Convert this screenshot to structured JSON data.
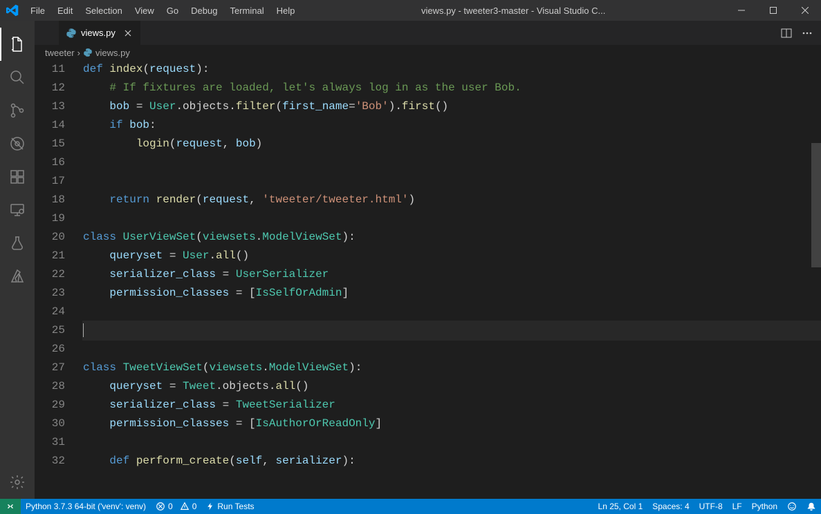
{
  "titlebar": {
    "title": "views.py - tweeter3-master - Visual Studio C...",
    "menus": [
      "File",
      "Edit",
      "Selection",
      "View",
      "Go",
      "Debug",
      "Terminal",
      "Help"
    ]
  },
  "activitybar": {
    "items": [
      {
        "name": "explorer-icon",
        "active": true
      },
      {
        "name": "search-icon",
        "active": false
      },
      {
        "name": "source-control-icon",
        "active": false
      },
      {
        "name": "debug-icon",
        "active": false
      },
      {
        "name": "extensions-icon",
        "active": false
      },
      {
        "name": "remote-explorer-icon",
        "active": false
      },
      {
        "name": "test-icon",
        "active": false
      },
      {
        "name": "azure-icon",
        "active": false
      }
    ],
    "bottom": [
      {
        "name": "settings-icon"
      }
    ]
  },
  "tab": {
    "filename": "views.py"
  },
  "breadcrumbs": {
    "segments": [
      "tweeter",
      "views.py"
    ]
  },
  "code": {
    "first_line_no": 11,
    "lines": [
      [
        [
          "tok-kw",
          "def"
        ],
        [
          "tok-punc",
          " "
        ],
        [
          "tok-fn",
          "index"
        ],
        [
          "tok-punc",
          "("
        ],
        [
          "tok-var",
          "request"
        ],
        [
          "tok-punc",
          "):"
        ]
      ],
      [
        [
          "tok-com",
          "    # If fixtures are loaded, let's always log in as the user Bob."
        ]
      ],
      [
        [
          "tok-punc",
          "    "
        ],
        [
          "tok-var",
          "bob"
        ],
        [
          "tok-punc",
          " = "
        ],
        [
          "tok-cls",
          "User"
        ],
        [
          "tok-punc",
          ".objects."
        ],
        [
          "tok-fn",
          "filter"
        ],
        [
          "tok-punc",
          "("
        ],
        [
          "tok-var",
          "first_name"
        ],
        [
          "tok-punc",
          "="
        ],
        [
          "tok-str",
          "'Bob'"
        ],
        [
          "tok-punc",
          ")."
        ],
        [
          "tok-fn",
          "first"
        ],
        [
          "tok-punc",
          "()"
        ]
      ],
      [
        [
          "tok-punc",
          "    "
        ],
        [
          "tok-kw",
          "if"
        ],
        [
          "tok-punc",
          " "
        ],
        [
          "tok-var",
          "bob"
        ],
        [
          "tok-punc",
          ":"
        ]
      ],
      [
        [
          "tok-punc",
          "        "
        ],
        [
          "tok-fn",
          "login"
        ],
        [
          "tok-punc",
          "("
        ],
        [
          "tok-var",
          "request"
        ],
        [
          "tok-punc",
          ", "
        ],
        [
          "tok-var",
          "bob"
        ],
        [
          "tok-punc",
          ")"
        ]
      ],
      [],
      [],
      [
        [
          "tok-punc",
          "    "
        ],
        [
          "tok-kw",
          "return"
        ],
        [
          "tok-punc",
          " "
        ],
        [
          "tok-fn",
          "render"
        ],
        [
          "tok-punc",
          "("
        ],
        [
          "tok-var",
          "request"
        ],
        [
          "tok-punc",
          ", "
        ],
        [
          "tok-str",
          "'tweeter/tweeter.html'"
        ],
        [
          "tok-punc",
          ")"
        ]
      ],
      [],
      [
        [
          "tok-kw",
          "class"
        ],
        [
          "tok-punc",
          " "
        ],
        [
          "tok-cls",
          "UserViewSet"
        ],
        [
          "tok-punc",
          "("
        ],
        [
          "tok-cls",
          "viewsets"
        ],
        [
          "tok-punc",
          "."
        ],
        [
          "tok-cls",
          "ModelViewSet"
        ],
        [
          "tok-punc",
          "):"
        ]
      ],
      [
        [
          "tok-punc",
          "    "
        ],
        [
          "tok-var",
          "queryset"
        ],
        [
          "tok-punc",
          " = "
        ],
        [
          "tok-cls",
          "User"
        ],
        [
          "tok-punc",
          "."
        ],
        [
          "tok-fn",
          "all"
        ],
        [
          "tok-punc",
          "()"
        ]
      ],
      [
        [
          "tok-punc",
          "    "
        ],
        [
          "tok-var",
          "serializer_class"
        ],
        [
          "tok-punc",
          " = "
        ],
        [
          "tok-cls",
          "UserSerializer"
        ]
      ],
      [
        [
          "tok-punc",
          "    "
        ],
        [
          "tok-var",
          "permission_classes"
        ],
        [
          "tok-punc",
          " = ["
        ],
        [
          "tok-cls",
          "IsSelfOrAdmin"
        ],
        [
          "tok-punc",
          "]"
        ]
      ],
      [],
      [],
      [],
      [
        [
          "tok-kw",
          "class"
        ],
        [
          "tok-punc",
          " "
        ],
        [
          "tok-cls",
          "TweetViewSet"
        ],
        [
          "tok-punc",
          "("
        ],
        [
          "tok-cls",
          "viewsets"
        ],
        [
          "tok-punc",
          "."
        ],
        [
          "tok-cls",
          "ModelViewSet"
        ],
        [
          "tok-punc",
          "):"
        ]
      ],
      [
        [
          "tok-punc",
          "    "
        ],
        [
          "tok-var",
          "queryset"
        ],
        [
          "tok-punc",
          " = "
        ],
        [
          "tok-cls",
          "Tweet"
        ],
        [
          "tok-punc",
          ".objects."
        ],
        [
          "tok-fn",
          "all"
        ],
        [
          "tok-punc",
          "()"
        ]
      ],
      [
        [
          "tok-punc",
          "    "
        ],
        [
          "tok-var",
          "serializer_class"
        ],
        [
          "tok-punc",
          " = "
        ],
        [
          "tok-cls",
          "TweetSerializer"
        ]
      ],
      [
        [
          "tok-punc",
          "    "
        ],
        [
          "tok-var",
          "permission_classes"
        ],
        [
          "tok-punc",
          " = ["
        ],
        [
          "tok-cls",
          "IsAuthorOrReadOnly"
        ],
        [
          "tok-punc",
          "]"
        ]
      ],
      [],
      [
        [
          "tok-punc",
          "    "
        ],
        [
          "tok-kw",
          "def"
        ],
        [
          "tok-punc",
          " "
        ],
        [
          "tok-fn",
          "perform_create"
        ],
        [
          "tok-punc",
          "("
        ],
        [
          "tok-var",
          "self"
        ],
        [
          "tok-punc",
          ", "
        ],
        [
          "tok-var",
          "serializer"
        ],
        [
          "tok-punc",
          "):"
        ]
      ]
    ],
    "current_line_index": 14
  },
  "statusbar": {
    "python_env": "Python 3.7.3 64-bit ('venv': venv)",
    "errors": "0",
    "warnings": "0",
    "run_tests": "Run Tests",
    "ln_col": "Ln 25, Col 1",
    "spaces": "Spaces: 4",
    "encoding": "UTF-8",
    "eol": "LF",
    "language": "Python"
  }
}
